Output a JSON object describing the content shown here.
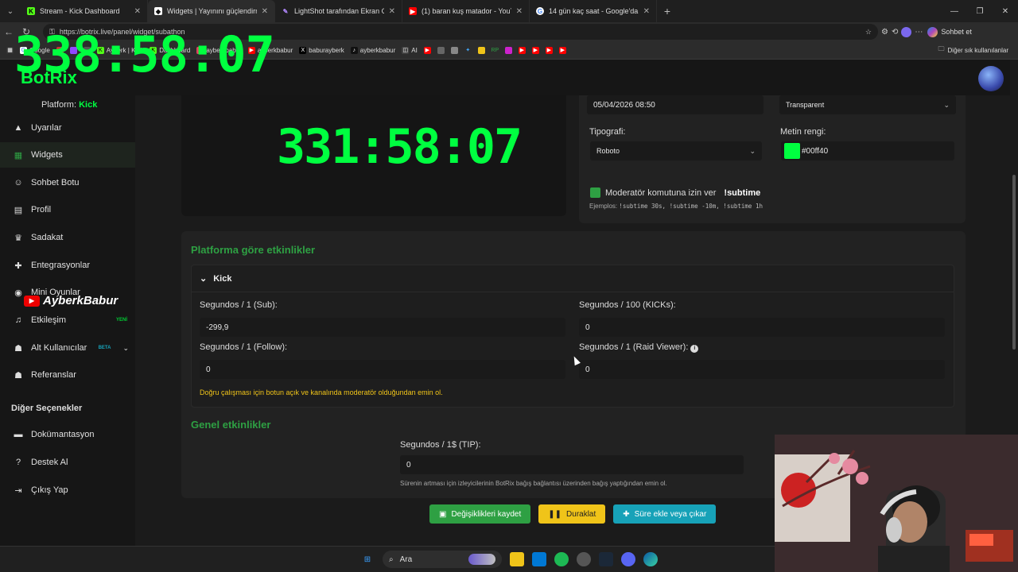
{
  "browser": {
    "tabs": [
      {
        "title": "Stream - Kick Dashboard",
        "icon": "kick-icon",
        "color": "#53fc18"
      },
      {
        "title": "Widgets | Yayınını güçlendirmek iç",
        "icon": "botrix-icon",
        "color": "#ffffff",
        "active": true
      },
      {
        "title": "LightShot tarafından Ekran Görünt",
        "icon": "feather-icon",
        "color": "#b388ff"
      },
      {
        "title": "(1) baran kuş matador - YouTube",
        "icon": "youtube-icon",
        "color": "#ff0000"
      },
      {
        "title": "14 gün kaç saat - Google'da Ara",
        "icon": "google-icon",
        "color": "#ffffff"
      }
    ],
    "url": "https://botrix.live/panel/widget/subathon",
    "sohbet_label": "Sohbet et",
    "bookmarks": [
      "Google",
      "",
      "",
      "",
      "Ayberk | Kick",
      "Dashboard",
      "ayberkbabur",
      "ayberkbabur",
      "baburayberk",
      "ayberkbabur",
      "AI"
    ],
    "other_bookmarks": "Diğer sık kullanılanlar"
  },
  "overlay_timer": "338:58:07",
  "app": {
    "logo": "BotRix",
    "platform_label": "Platform:",
    "platform_value": "Kick",
    "sidebar": [
      {
        "label": "Uyarılar",
        "icon": "warning-icon"
      },
      {
        "label": "Widgets",
        "icon": "grid-icon",
        "active": true
      },
      {
        "label": "Sohbet Botu",
        "icon": "robot-icon"
      },
      {
        "label": "Profil",
        "icon": "profile-icon"
      },
      {
        "label": "Sadakat",
        "icon": "trophy-icon"
      },
      {
        "label": "Entegrasyonlar",
        "icon": "puzzle-icon"
      },
      {
        "label": "Mini Oyunlar",
        "icon": "gamepad-icon"
      },
      {
        "label": "Etkileşim",
        "icon": "music-icon",
        "badge": "YENİ"
      },
      {
        "label": "Alt Kullanıcılar",
        "icon": "users-icon",
        "badge": "BETA"
      },
      {
        "label": "Referanslar",
        "icon": "referral-icon"
      }
    ],
    "other_options_heading": "Diğer Seçenekler",
    "other_items": [
      {
        "label": "Dokümantasyon",
        "icon": "docs-icon"
      },
      {
        "label": "Destek Al",
        "icon": "help-icon"
      },
      {
        "label": "Çıkış Yap",
        "icon": "logout-icon"
      }
    ],
    "streamer_badge": "AyberkBabur"
  },
  "preview": {
    "timer": "331:58:07"
  },
  "settings": {
    "end_date": "05/04/2026 08:50",
    "background_select": "Transparent",
    "typography_label": "Tipografi:",
    "typography_value": "Roboto",
    "text_color_label": "Metin rengi:",
    "text_color_value": "#00ff40",
    "mod_checkbox_label": "Moderatör komutuna izin ver",
    "mod_command": "!subtime",
    "examples_label": "Ejemplos:",
    "examples": "!subtime 30s, !subtime -10m, !subtime 1h"
  },
  "platform_events": {
    "heading": "Platforma göre etkinlikler",
    "kick_label": "Kick",
    "sub_label": "Segundos / 1 (Sub):",
    "sub_value": "-299,9",
    "kicks_label": "Segundos / 100 (KICKs):",
    "kicks_value": "0",
    "follow_label": "Segundos / 1 (Follow):",
    "follow_value": "0",
    "raid_label": "Segundos / 1 (Raid Viewer):",
    "raid_value": "0",
    "warning": "Doğru çalışması için botun açık ve kanalında moderatör olduğundan emin ol."
  },
  "general_events": {
    "heading": "Genel etkinlikler",
    "tip_label": "Segundos / 1$ (TIP):",
    "tip_value": "0",
    "tip_hint": "Sürenin artması için izleyicilerinin BotRix bağış bağlantısı üzerinden bağış yaptığından emin ol."
  },
  "buttons": {
    "save": "Değişiklikleri kaydet",
    "pause": "Duraklat",
    "add_time": "Süre ekle veya çıkar"
  },
  "taskbar": {
    "search_placeholder": "Ara"
  }
}
